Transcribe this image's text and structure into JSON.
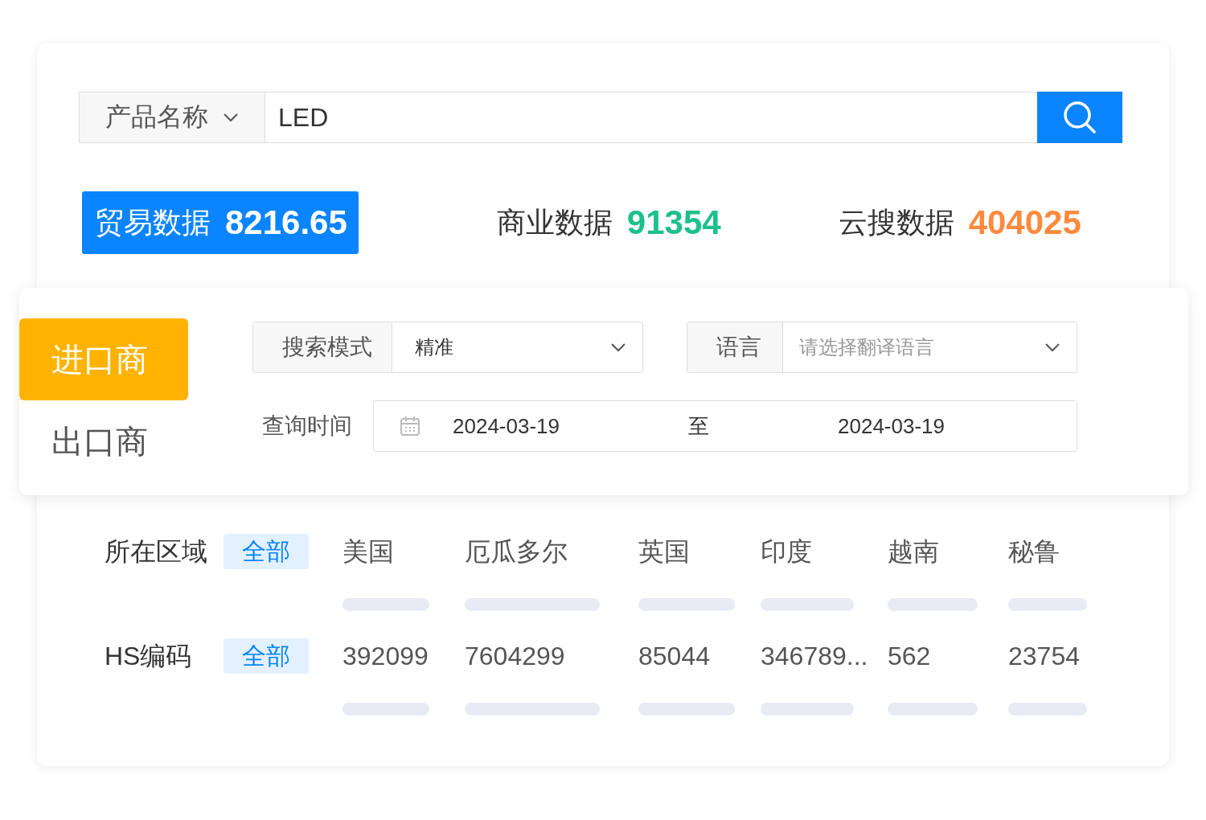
{
  "search": {
    "field_select": "产品名称",
    "value": "LED"
  },
  "stats": [
    {
      "label": "贸易数据",
      "value": "8216.65",
      "selected": true
    },
    {
      "label": "商业数据",
      "value": "91354",
      "selected": false,
      "color": "#1cc08b"
    },
    {
      "label": "云搜数据",
      "value": "404025",
      "selected": false,
      "color": "#ff8a3d"
    }
  ],
  "side_tabs": [
    {
      "label": "进口商",
      "selected": true
    },
    {
      "label": "出口商",
      "selected": false
    }
  ],
  "search_mode": {
    "label": "搜索模式",
    "value": "精准"
  },
  "language": {
    "label": "语言",
    "placeholder": "请选择翻译语言"
  },
  "query_time": {
    "label": "查询时间",
    "start": "2024-03-19",
    "separator": "至",
    "end": "2024-03-19"
  },
  "filters": [
    {
      "label": "所在区域",
      "all": {
        "text": "全部",
        "selected": true
      },
      "options": [
        "美国",
        "厄瓜多尔",
        "英国",
        "印度",
        "越南",
        "秘鲁"
      ]
    },
    {
      "label": "HS编码",
      "all": {
        "text": "全部",
        "selected": true
      },
      "options": [
        "392099",
        "7604299",
        "85044",
        "346789...",
        "562",
        "23754"
      ]
    }
  ]
}
